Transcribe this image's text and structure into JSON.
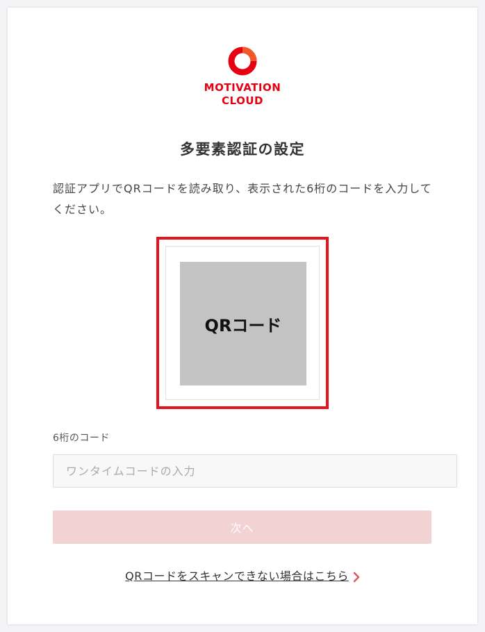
{
  "brand": {
    "name_line1": "MOTIVATION",
    "name_line2": "CLOUD",
    "color": "#e60012",
    "logo_icon": "ring-logo-icon"
  },
  "page": {
    "title": "多要素認証の設定",
    "description": "認証アプリでQRコードを読み取り、表示された6桁のコードを入力してください。"
  },
  "qr": {
    "placeholder_label": "QRコード",
    "highlight_color": "#e4141e"
  },
  "form": {
    "code_label": "6桁のコード",
    "code_value": "",
    "code_placeholder": "ワンタイムコードの入力",
    "next_label": "次へ"
  },
  "help": {
    "link_text": "QRコードをスキャンできない場合はこちら",
    "icon": "chevron-right-icon"
  }
}
